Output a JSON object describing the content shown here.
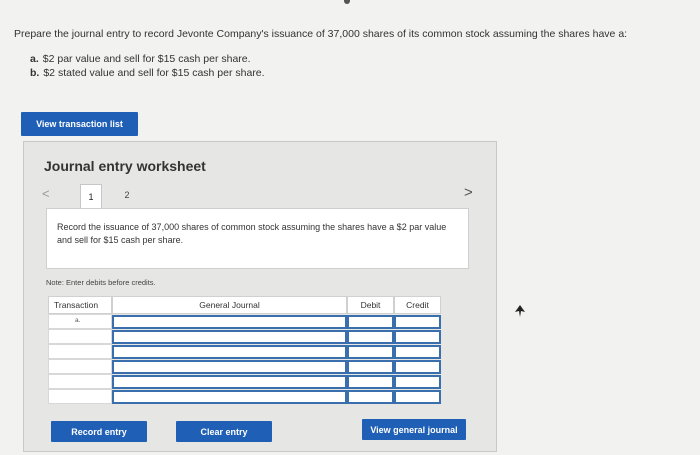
{
  "question": {
    "text": "Prepare the journal entry to record Jevonte Company's issuance of 37,000 shares of its common stock assuming the shares have a:",
    "parts": [
      {
        "label": "a.",
        "text": "$2 par value and sell for $15 cash per share."
      },
      {
        "label": "b.",
        "text": "$2 stated value and sell for $15 cash per share."
      }
    ]
  },
  "buttons": {
    "view_transaction_list": "View transaction list",
    "record_entry": "Record entry",
    "clear_entry": "Clear entry",
    "view_general_journal": "View general journal"
  },
  "worksheet": {
    "title": "Journal entry worksheet",
    "prev_icon": "<",
    "next_icon": ">",
    "tabs": [
      "1",
      "2"
    ],
    "active_tab": "1",
    "instruction": "Record the issuance of 37,000 shares of common stock assuming the shares have a $2 par value and sell for $15 cash per share.",
    "note": "Note: Enter debits before credits."
  },
  "journal_table": {
    "headers": {
      "transaction": "Transaction",
      "general_journal": "General Journal",
      "debit": "Debit",
      "credit": "Credit"
    },
    "rows": [
      {
        "transaction": "a."
      },
      {
        "transaction": ""
      },
      {
        "transaction": ""
      },
      {
        "transaction": ""
      },
      {
        "transaction": ""
      },
      {
        "transaction": ""
      }
    ]
  },
  "colors": {
    "button_blue": "#1f5fb5",
    "input_border": "#3a6fae"
  }
}
